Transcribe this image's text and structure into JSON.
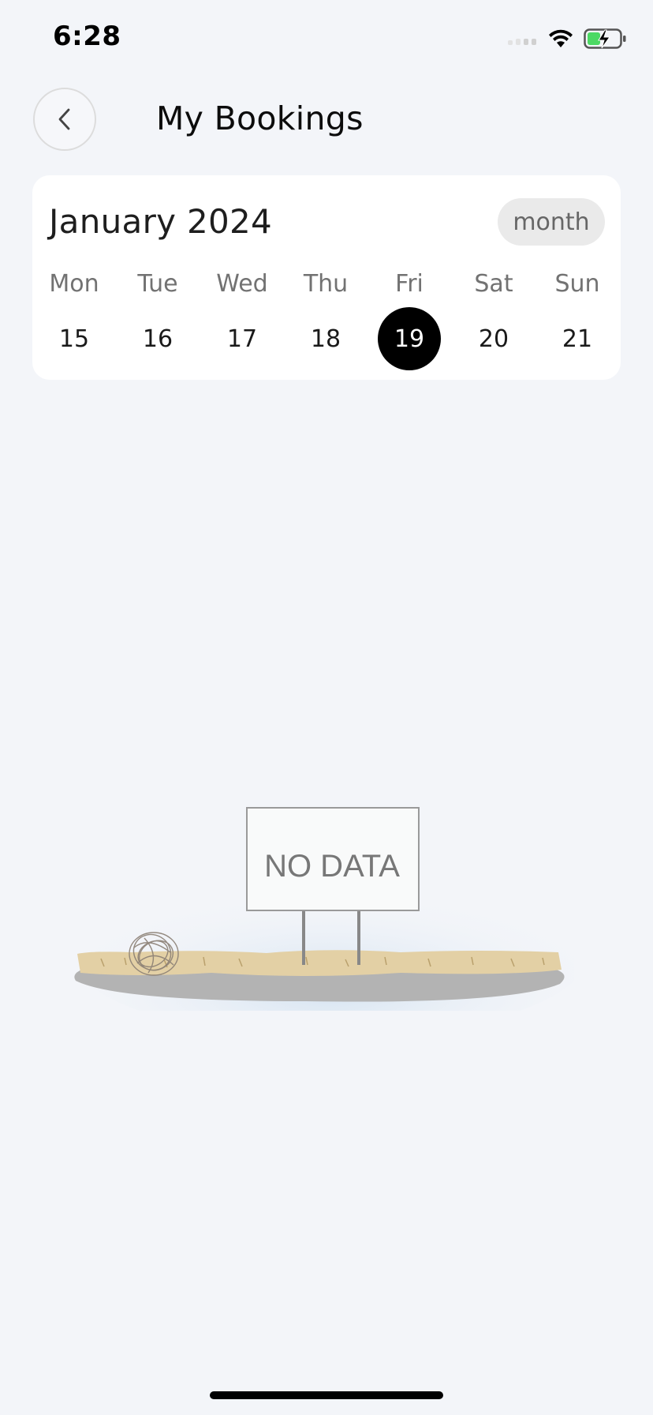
{
  "status_bar": {
    "time": "6:28"
  },
  "header": {
    "title": "My Bookings"
  },
  "calendar": {
    "month_label": "January 2024",
    "view_toggle_label": "month",
    "days": [
      {
        "name": "Mon",
        "date": "15",
        "selected": false
      },
      {
        "name": "Tue",
        "date": "16",
        "selected": false
      },
      {
        "name": "Wed",
        "date": "17",
        "selected": false
      },
      {
        "name": "Thu",
        "date": "18",
        "selected": false
      },
      {
        "name": "Fri",
        "date": "19",
        "selected": true
      },
      {
        "name": "Sat",
        "date": "20",
        "selected": false
      },
      {
        "name": "Sun",
        "date": "21",
        "selected": false
      }
    ]
  },
  "empty_state": {
    "sign_text": "NO DATA"
  },
  "colors": {
    "background": "#f3f5f9",
    "card": "#ffffff",
    "selected_day": "#000000",
    "toggle_bg": "#eaeaea",
    "battery_green": "#4cd964"
  }
}
